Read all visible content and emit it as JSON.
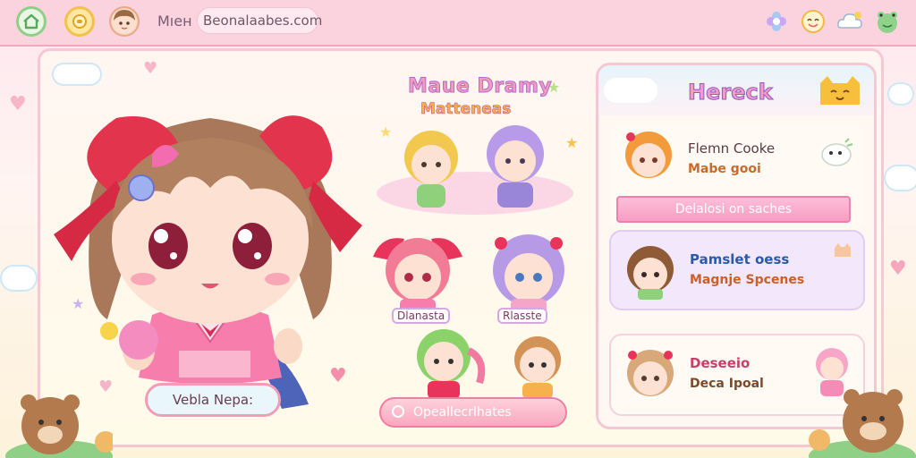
{
  "topbar": {
    "label": "Mıeн :",
    "search_value": "Beonalaabes.com",
    "icons": [
      "home-icon",
      "coin-icon",
      "avatar-icon",
      "flower-icon",
      "smiley-icon",
      "cloud-icon",
      "frog-icon"
    ]
  },
  "main_character": {
    "nameplate": "Vebla Nepa:"
  },
  "group": {
    "title": "Maue Dramy",
    "subtitle": "Matteneas",
    "labels": [
      "Dlanasta",
      "Rlasste"
    ],
    "action_label": "Opeallecrlhates"
  },
  "right_panel": {
    "title": "Hereck",
    "cards": [
      {
        "name": "Flemn Cooke",
        "sub": "Mabe gooi",
        "ribbon": "Delalosi on saches"
      },
      {
        "name": "Pamslet oess",
        "sub": "Magnje Spcenes"
      },
      {
        "name": "Deseeio",
        "sub": "Deca Ipoal"
      }
    ]
  },
  "colors": {
    "accent_pink": "#f39bb7",
    "accent_purple": "#b06ec9",
    "topbar": "#fbd3df"
  }
}
